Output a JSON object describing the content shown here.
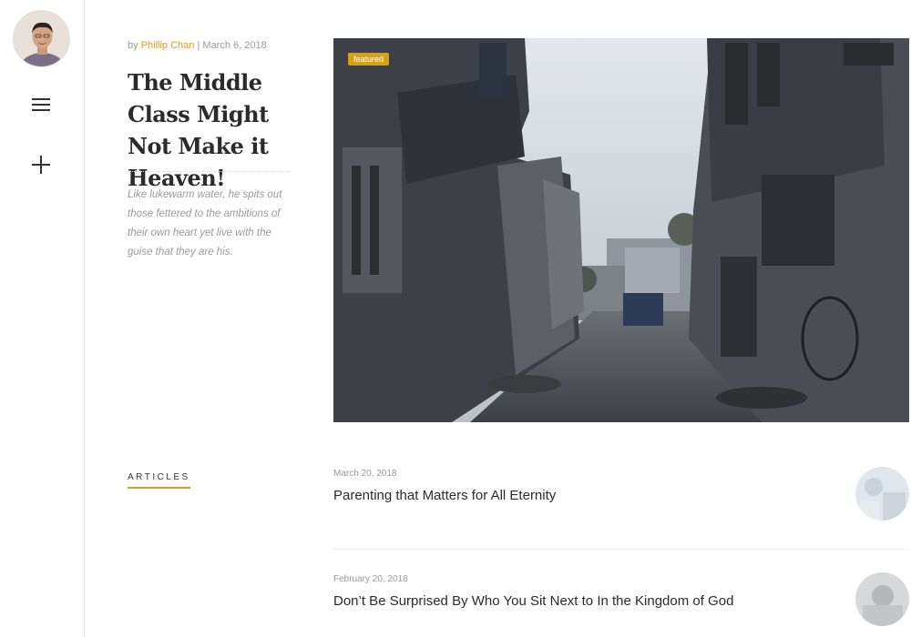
{
  "sidebar": {
    "avatar_icon": "user-avatar",
    "menu_icon": "hamburger-menu-icon",
    "add_icon": "plus-icon"
  },
  "featured_post": {
    "by_label": "by",
    "author": "Phillip Chan",
    "separator": "|",
    "date": "March 6, 2018",
    "title": "The Middle Class Might Not Make it Heaven!",
    "excerpt": "Like lukewarm water, he spits out those fettered to the ambitions of their own heart yet live with the guise that they are his.",
    "badge": "featured"
  },
  "articles_section": {
    "label": "ARTICLES",
    "items": [
      {
        "date": "March 20, 2018",
        "title": "Parenting that Matters for All Eternity"
      },
      {
        "date": "February 20, 2018",
        "title": "Don’t Be Surprised By Who You Sit Next to In the Kingdom of God"
      }
    ]
  },
  "colors": {
    "accent": "#d4a21a",
    "text": "#2b2b2b",
    "muted": "#9a9a9a"
  }
}
